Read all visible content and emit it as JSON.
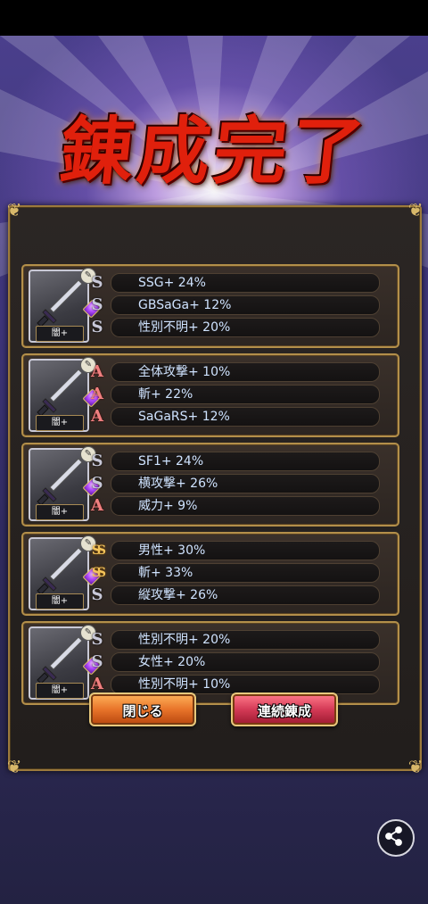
{
  "title": "錬成完了",
  "cards": [
    {
      "rank_label": "闇+",
      "rows": [
        {
          "rank": "S",
          "text": "SSG+ 24%"
        },
        {
          "rank": "S",
          "text": "GBSaGa+ 12%"
        },
        {
          "rank": "S",
          "text": "性別不明+ 20%"
        }
      ]
    },
    {
      "rank_label": "闇+",
      "rows": [
        {
          "rank": "A",
          "text": "全体攻撃+ 10%"
        },
        {
          "rank": "A",
          "text": "斬+ 22%"
        },
        {
          "rank": "A",
          "text": "SaGaRS+ 12%"
        }
      ]
    },
    {
      "rank_label": "闇+",
      "rows": [
        {
          "rank": "S",
          "text": "SF1+ 24%"
        },
        {
          "rank": "S",
          "text": "横攻撃+ 26%"
        },
        {
          "rank": "A",
          "text": "威力+ 9%"
        }
      ]
    },
    {
      "rank_label": "闇+",
      "rows": [
        {
          "rank": "SS",
          "text": "男性+ 30%"
        },
        {
          "rank": "SS",
          "text": "斬+ 33%"
        },
        {
          "rank": "S",
          "text": "縦攻撃+ 26%"
        }
      ]
    },
    {
      "rank_label": "闇+",
      "rows": [
        {
          "rank": "S",
          "text": "性別不明+ 20%"
        },
        {
          "rank": "S",
          "text": "女性+ 20%"
        },
        {
          "rank": "A",
          "text": "性別不明+ 10%"
        }
      ]
    }
  ],
  "buttons": {
    "close": "閉じる",
    "continue": "連続錬成"
  },
  "icons": {
    "share": "share-icon",
    "weapon": "sword-icon",
    "pen": "pen-icon",
    "gem": "gem-icon"
  },
  "colors": {
    "accent_gold": "#b38f4a",
    "title_red": "#e0200c",
    "text_blue": "#cfe3ff"
  }
}
